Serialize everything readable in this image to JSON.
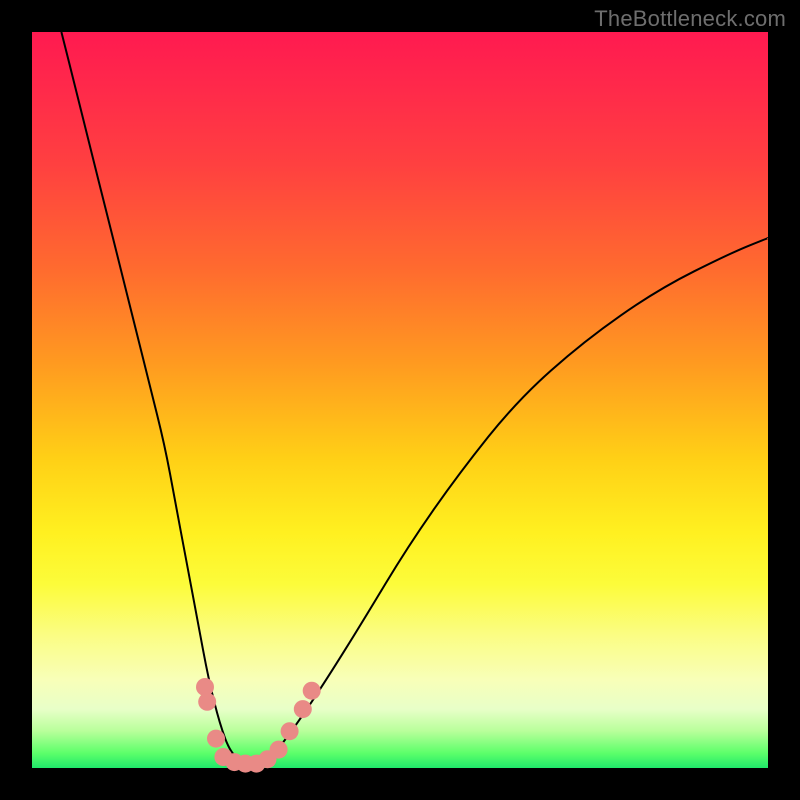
{
  "watermark": {
    "text": "TheBottleneck.com"
  },
  "chart_data": {
    "type": "line",
    "title": "",
    "xlabel": "",
    "ylabel": "",
    "xlim": [
      0,
      100
    ],
    "ylim": [
      0,
      100
    ],
    "grid": false,
    "annotations": [],
    "curve_points_pct": [
      [
        4,
        100
      ],
      [
        6,
        92
      ],
      [
        8,
        84
      ],
      [
        10,
        76
      ],
      [
        12,
        68
      ],
      [
        14,
        60
      ],
      [
        16,
        52
      ],
      [
        18,
        44
      ],
      [
        19.5,
        36
      ],
      [
        21,
        28
      ],
      [
        22.5,
        20
      ],
      [
        24,
        12
      ],
      [
        25.5,
        6
      ],
      [
        27,
        2
      ],
      [
        29,
        0.5
      ],
      [
        31,
        0.5
      ],
      [
        33,
        2
      ],
      [
        36,
        6
      ],
      [
        40,
        12
      ],
      [
        45,
        20
      ],
      [
        51,
        30
      ],
      [
        58,
        40
      ],
      [
        66,
        50
      ],
      [
        75,
        58
      ],
      [
        85,
        65
      ],
      [
        95,
        70
      ],
      [
        100,
        72
      ]
    ],
    "markers_pct": [
      [
        23.5,
        11
      ],
      [
        23.8,
        9
      ],
      [
        25.0,
        4
      ],
      [
        26.0,
        1.5
      ],
      [
        27.5,
        0.8
      ],
      [
        29.0,
        0.6
      ],
      [
        30.5,
        0.6
      ],
      [
        32.0,
        1.2
      ],
      [
        33.5,
        2.5
      ],
      [
        35.0,
        5
      ],
      [
        36.8,
        8
      ],
      [
        38.0,
        10.5
      ]
    ],
    "marker_color": "#e98a86",
    "curve_color": "#000000"
  }
}
